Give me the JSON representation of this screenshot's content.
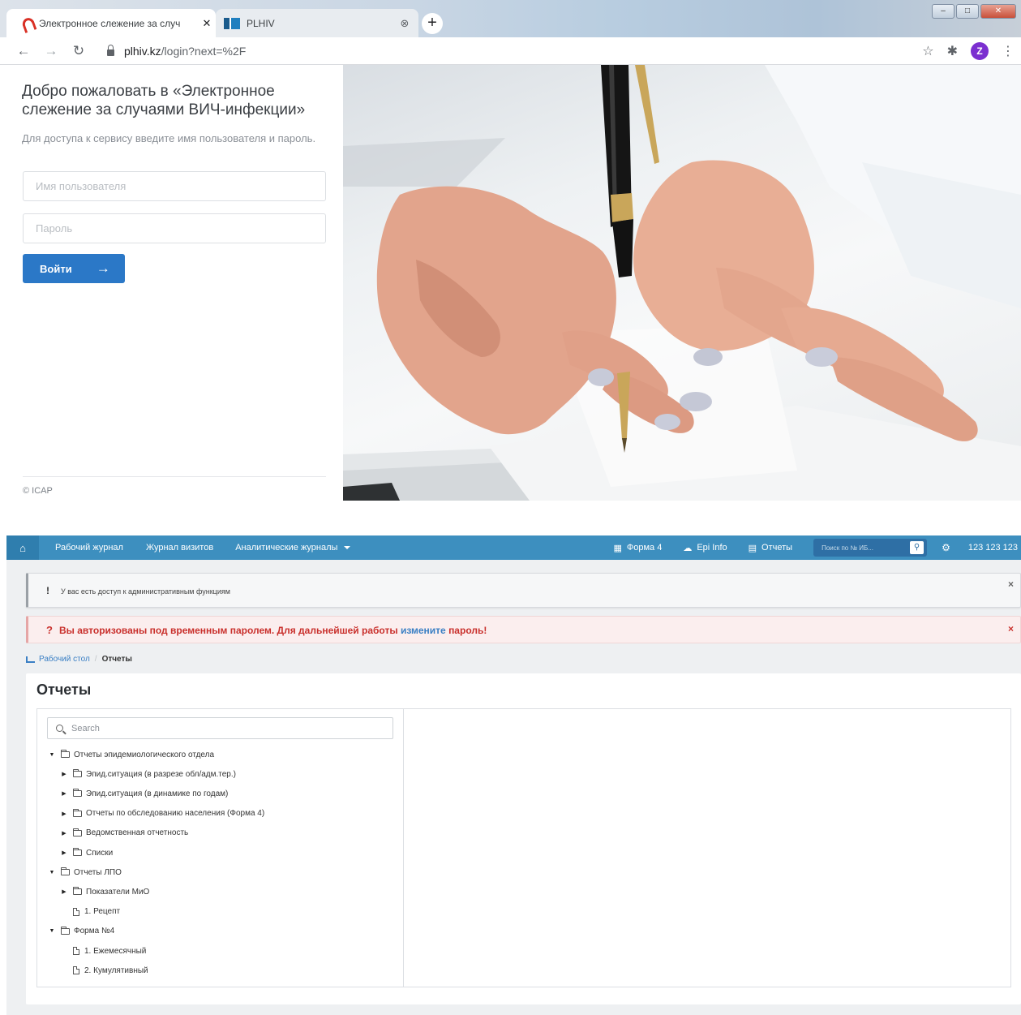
{
  "browser": {
    "tabs": [
      {
        "label": "Электронное слежение за случ",
        "icon": "pdf-icon",
        "active": true
      },
      {
        "label": "PLHIV",
        "icon": "plhiv-favicon",
        "active": false
      }
    ],
    "new_tab": "+",
    "url_host": "plhiv.kz",
    "url_path": "/login?next=%2F",
    "profile_initial": "Z"
  },
  "login": {
    "welcome": "Добро пожаловать в «Электронное слежение за случаями ВИЧ-инфекции»",
    "subtitle": "Для доступа к сервису введите имя пользователя и пароль.",
    "username_placeholder": "Имя пользователя",
    "password_placeholder": "Пароль",
    "submit_label": "Войти",
    "copyright": "© ICAP"
  },
  "app": {
    "navbar": {
      "links": [
        "Рабочий журнал",
        "Журнал визитов",
        "Аналитические журналы"
      ],
      "forma4": "Форма 4",
      "epi": "Epi Info",
      "reports": "Отчеты",
      "search_placeholder": "Поиск по № ИБ...",
      "user": "123 123 123"
    },
    "alerts": {
      "info_mark": "!",
      "info": "У вас есть доступ к административным функциям",
      "warn_mark": "?",
      "warn_before": "Вы авторизованы под временным паролем. Для дальнейшей работы",
      "warn_link": "измените",
      "warn_after": "пароль!",
      "close": "×"
    },
    "breadcrumb": {
      "home": "Рабочий стол",
      "sep": "/",
      "current": "Отчеты"
    },
    "page_title": "Отчеты",
    "tree_search_placeholder": "Search",
    "tree": [
      {
        "label": "Отчеты эпидемиологического отдела",
        "level": 0,
        "type": "folder",
        "toggle": "▼"
      },
      {
        "label": "Эпид.ситуация (в разрезе обл/адм.тер.)",
        "level": 1,
        "type": "folder",
        "toggle": "▶"
      },
      {
        "label": "Эпид.ситуация (в динамике по годам)",
        "level": 1,
        "type": "folder",
        "toggle": "▶"
      },
      {
        "label": "Отчеты по обследованию населения (Форма 4)",
        "level": 1,
        "type": "folder",
        "toggle": "▶"
      },
      {
        "label": "Ведомственная отчетность",
        "level": 1,
        "type": "folder",
        "toggle": "▶"
      },
      {
        "label": "Списки",
        "level": 1,
        "type": "folder",
        "toggle": "▶"
      },
      {
        "label": "Отчеты ЛПО",
        "level": 0,
        "type": "folder",
        "toggle": "▼"
      },
      {
        "label": "Показатели МиО",
        "level": 1,
        "type": "folder",
        "toggle": "▶"
      },
      {
        "label": "1. Рецепт",
        "level": 1,
        "type": "file",
        "toggle": ""
      },
      {
        "label": "Форма №4",
        "level": 0,
        "type": "folder",
        "toggle": "▼"
      },
      {
        "label": "1. Ежемесячный",
        "level": 1,
        "type": "file",
        "toggle": ""
      },
      {
        "label": "2. Кумулятивный",
        "level": 1,
        "type": "file",
        "toggle": ""
      }
    ]
  },
  "colors": {
    "navbar": "#3d8fbf",
    "primary_button": "#2b78c7",
    "warning_text": "#c9302c",
    "link": "#3a7fc4"
  }
}
